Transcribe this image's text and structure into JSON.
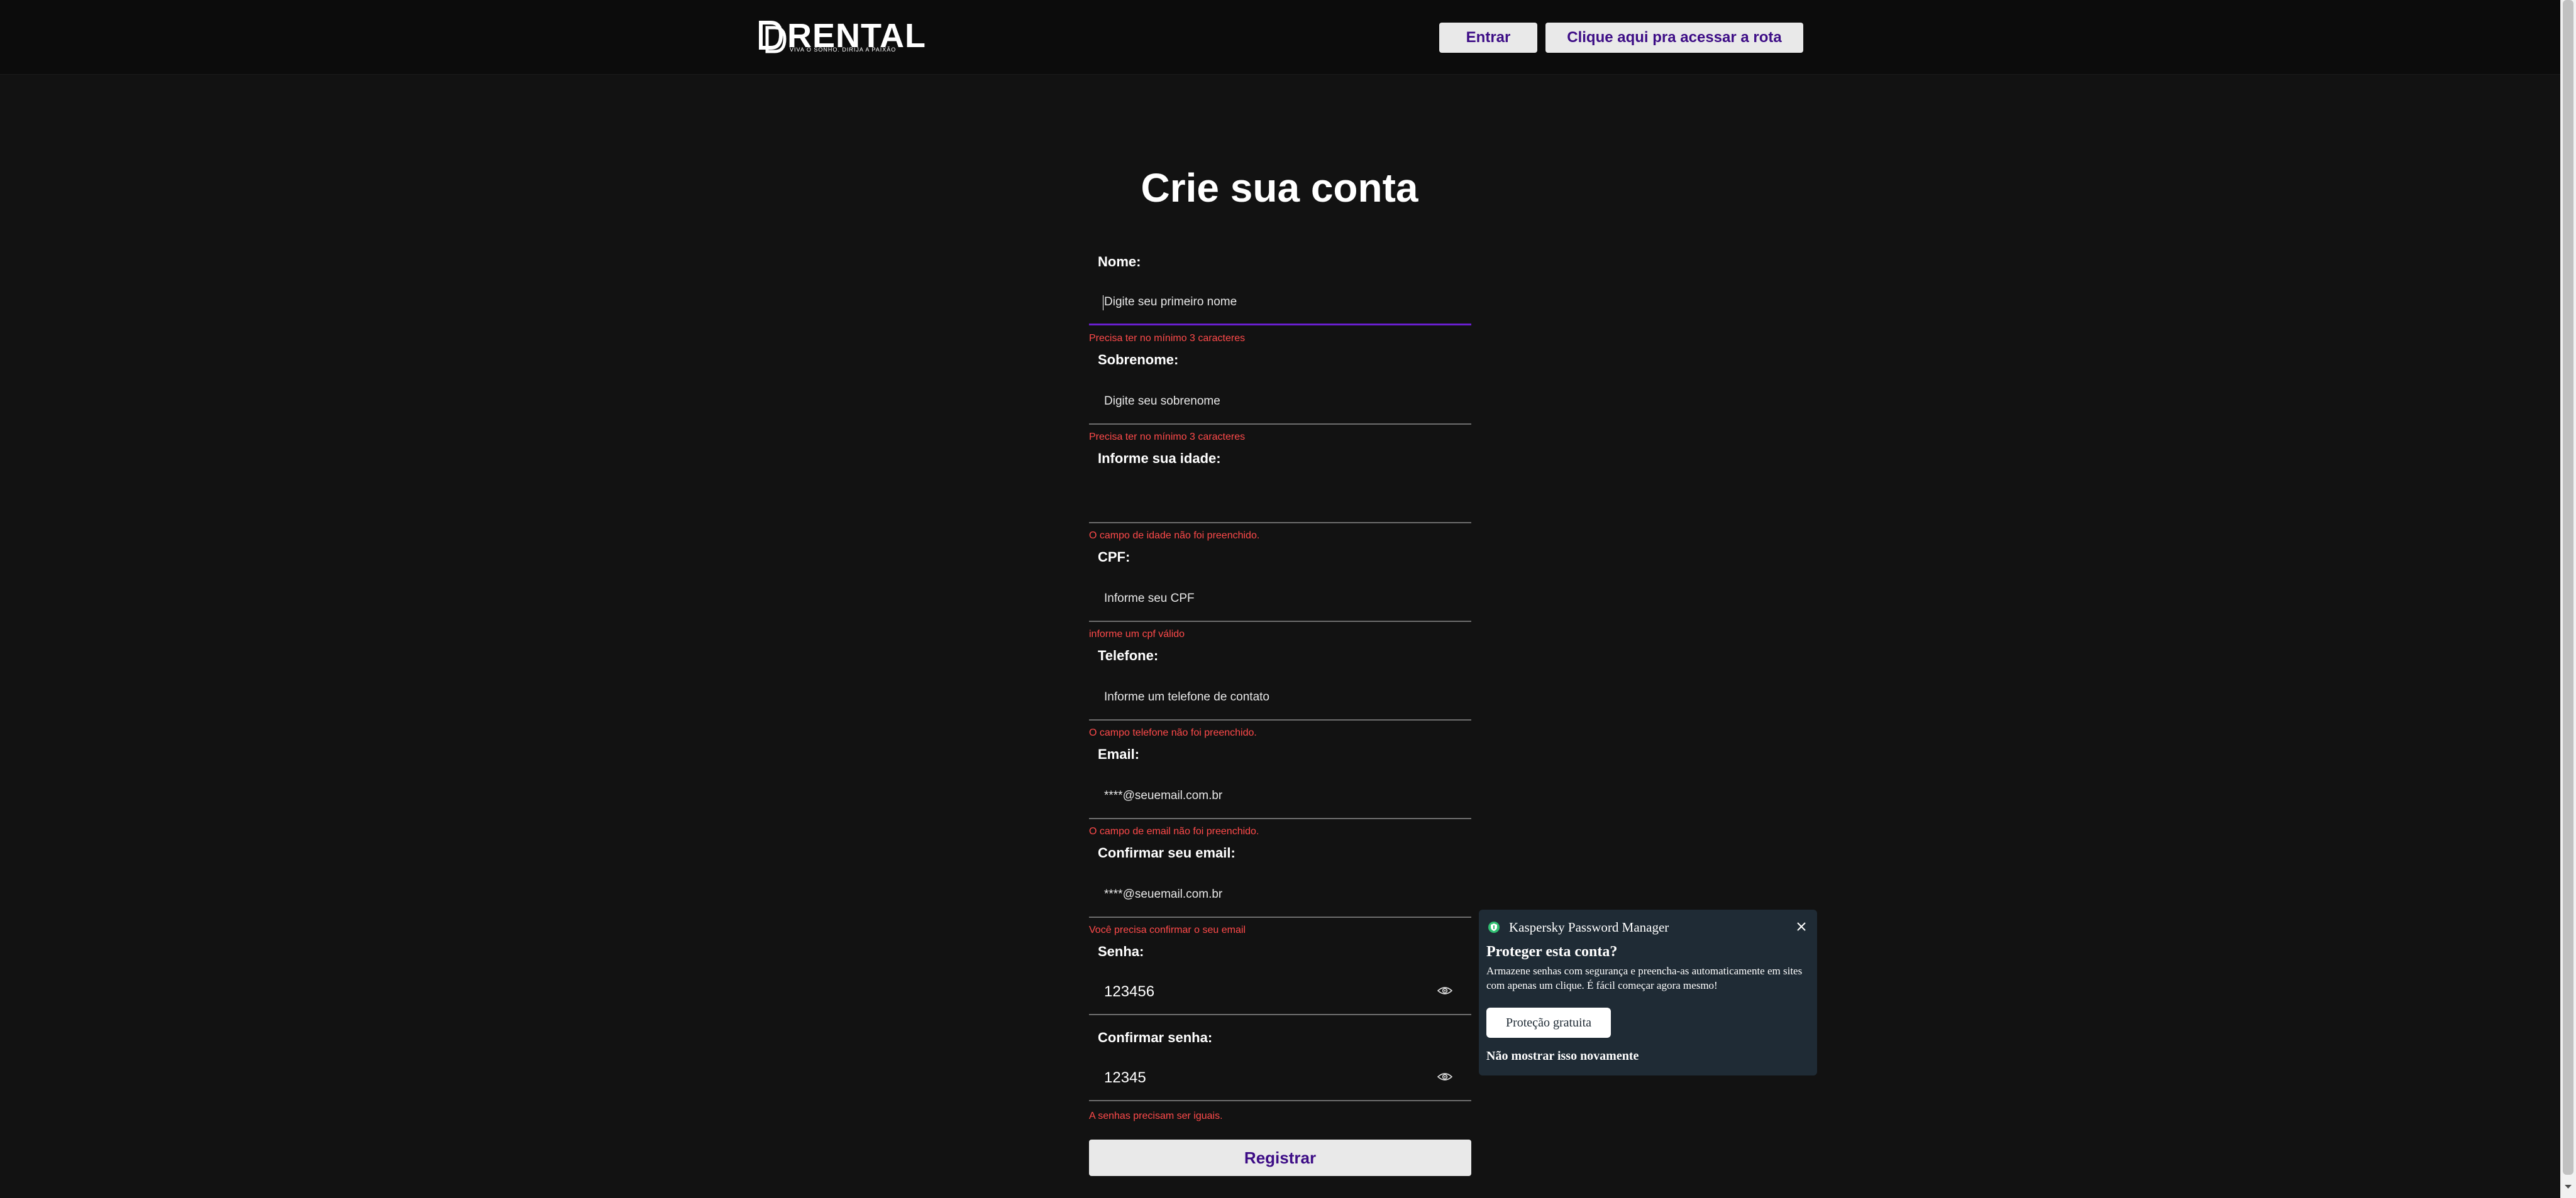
{
  "header": {
    "logo_text": "RENTAL",
    "logo_tagline": "VIVA O SONHO. DIRIJA A PAIXÃO",
    "login_button": "Entrar",
    "route_button": "Clique aqui pra acessar a rota"
  },
  "form": {
    "title": "Crie sua conta",
    "fields": [
      {
        "label": "Nome:",
        "placeholder": "Digite seu primeiro nome",
        "value": "",
        "error": "Precisa ter no mínimo 3 caracteres"
      },
      {
        "label": "Sobrenome:",
        "placeholder": "Digite seu sobrenome",
        "value": "",
        "error": "Precisa ter no mínimo 3 caracteres"
      },
      {
        "label": "Informe sua idade:",
        "placeholder": "",
        "value": "",
        "error": "O campo de idade não foi preenchido."
      },
      {
        "label": "CPF:",
        "placeholder": "Informe seu CPF",
        "value": "",
        "error": "informe um cpf válido"
      },
      {
        "label": "Telefone:",
        "placeholder": "Informe um telefone de contato",
        "value": "",
        "error": "O campo telefone não foi preenchido."
      },
      {
        "label": "Email:",
        "placeholder": "****@seuemail.com.br",
        "value": "",
        "error": "O campo de email não foi preenchido."
      },
      {
        "label": "Confirmar seu email:",
        "placeholder": "****@seuemail.com.br",
        "value": "",
        "error": "Você precisa confirmar o seu email"
      },
      {
        "label": "Senha:",
        "placeholder": "",
        "value": "123456",
        "error": ""
      },
      {
        "label": "Confirmar senha:",
        "placeholder": "",
        "value": "12345",
        "error": "A senhas precisam ser iguais."
      }
    ],
    "submit_label": "Registrar"
  },
  "password_manager": {
    "brand": "Kaspersky Password Manager",
    "title": "Proteger esta conta?",
    "body": "Armazene senhas com segurança e preencha-as automaticamente em sites com apenas um clique. É fácil começar agora mesmo!",
    "cta_button": "Proteção gratuita",
    "dismiss_link": "Não mostrar isso novamente",
    "accent_color": "#2fbf71",
    "background_color": "#1f2b35"
  },
  "colors": {
    "page_background": "#121212",
    "header_background": "#0c0c0c",
    "button_text": "#3d0d86",
    "error": "#ff4a4a",
    "focus_underline": "#6a1fd1"
  },
  "icons": [
    "eye-icon",
    "shield-icon",
    "close-icon",
    "chevron-down-icon"
  ]
}
